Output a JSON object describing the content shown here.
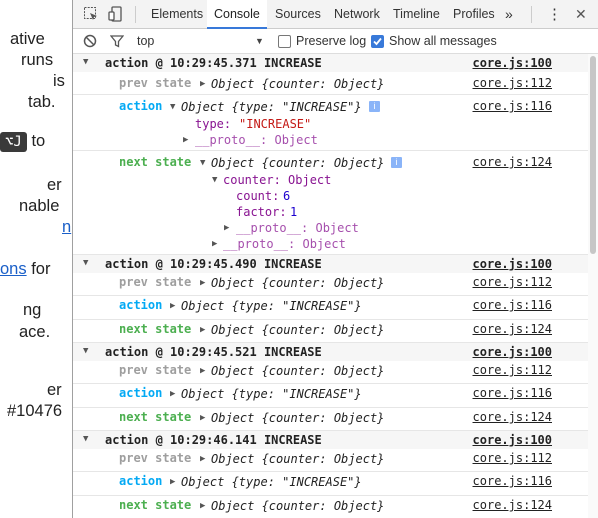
{
  "left_page": {
    "lines": [
      "ative",
      "runs",
      "is",
      "tab.",
      "to",
      "er",
      "nable",
      "n",
      "ons",
      "for",
      "ng",
      "ace.",
      "er",
      "#10476"
    ],
    "kbd": "⌥J"
  },
  "toolbar": {
    "tabs": [
      "Elements",
      "Console",
      "Sources",
      "Network",
      "Timeline",
      "Profiles"
    ],
    "more": "»",
    "menu": "⋮",
    "close": "✕"
  },
  "filter": {
    "context": "top",
    "preserve_log": "Preserve log",
    "show_all": "Show all messages"
  },
  "log": {
    "groups": [
      {
        "title": "action @ 10:29:45.371 INCREASE",
        "src": "core.js:100",
        "prev_label": "prev state",
        "prev_val": "Object {counter: Object}",
        "prev_src": "core.js:112",
        "action_label": "action",
        "action_val": "Object {type: \"INCREASE\"}",
        "action_src": "core.js:116",
        "action_type_key": "type:",
        "action_type_val": "\"INCREASE\"",
        "action_proto": "__proto__: Object",
        "next_label": "next state",
        "next_val": "Object {counter: Object}",
        "next_src": "core.js:124",
        "counter_line": "counter: Object",
        "count_key": "count:",
        "count_val": "6",
        "factor_key": "factor:",
        "factor_val": "1",
        "inner_proto": "__proto__: Object",
        "outer_proto": "__proto__: Object"
      },
      {
        "title": "action @ 10:29:45.490 INCREASE",
        "src": "core.js:100",
        "prev_label": "prev state",
        "prev_val": "Object {counter: Object}",
        "prev_src": "core.js:112",
        "action_label": "action",
        "action_val": "Object {type: \"INCREASE\"}",
        "action_src": "core.js:116",
        "next_label": "next state",
        "next_val": "Object {counter: Object}",
        "next_src": "core.js:124"
      },
      {
        "title": "action @ 10:29:45.521 INCREASE",
        "src": "core.js:100",
        "prev_label": "prev state",
        "prev_val": "Object {counter: Object}",
        "prev_src": "core.js:112",
        "action_label": "action",
        "action_val": "Object {type: \"INCREASE\"}",
        "action_src": "core.js:116",
        "next_label": "next state",
        "next_val": "Object {counter: Object}",
        "next_src": "core.js:124"
      },
      {
        "title": "action @ 10:29:46.141 INCREASE",
        "src": "core.js:100",
        "prev_label": "prev state",
        "prev_val": "Object {counter: Object}",
        "prev_src": "core.js:112",
        "action_label": "action",
        "action_val": "Object {type: \"INCREASE\"}",
        "action_src": "core.js:116",
        "next_label": "next state",
        "next_val": "Object {counter: Object}",
        "next_src": "core.js:124"
      }
    ]
  }
}
